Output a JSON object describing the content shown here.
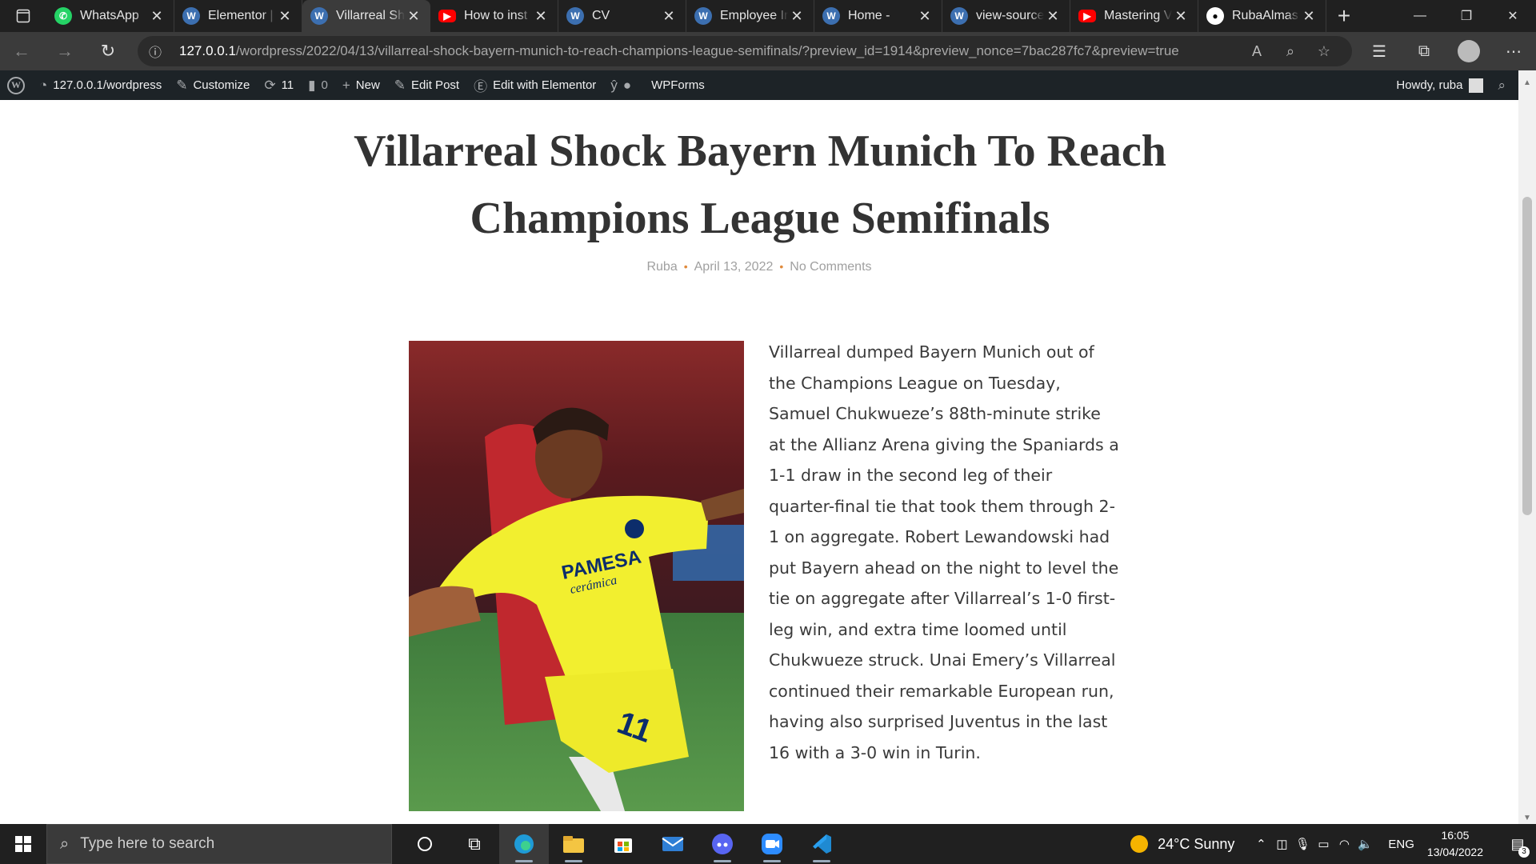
{
  "browser": {
    "tabs": [
      {
        "title": "WhatsApp",
        "favicon": "whatsapp-icon",
        "color": "#25D366",
        "active": false
      },
      {
        "title": "Elementor |",
        "favicon": "elementor-icon",
        "color": "#3c6fb0",
        "active": false
      },
      {
        "title": "Villarreal Sh",
        "favicon": "wordpress-icon",
        "color": "#3c6fb0",
        "active": true
      },
      {
        "title": "How to inst",
        "favicon": "youtube-icon",
        "color": "#ff0000",
        "active": false
      },
      {
        "title": "CV",
        "favicon": "wordpress-icon",
        "color": "#3c6fb0",
        "active": false
      },
      {
        "title": "Employee Ir",
        "favicon": "wordpress-icon",
        "color": "#3c6fb0",
        "active": false
      },
      {
        "title": "Home -",
        "favicon": "wordpress-icon",
        "color": "#3c6fb0",
        "active": false
      },
      {
        "title": "view-source",
        "favicon": "wordpress-icon",
        "color": "#3c6fb0",
        "active": false
      },
      {
        "title": "Mastering V",
        "favicon": "youtube-icon",
        "color": "#ff0000",
        "active": false
      },
      {
        "title": "RubaAlmas",
        "favicon": "github-icon",
        "color": "#000000",
        "active": false
      }
    ],
    "url_host": "127.0.0.1",
    "url_path": "/wordpress/2022/04/13/villarreal-shock-bayern-munich-to-reach-champions-league-semifinals/?preview_id=1914&preview_nonce=7bac287fc7&preview=true"
  },
  "adminbar": {
    "site": "127.0.0.1/wordpress",
    "customize": "Customize",
    "updates": "11",
    "comments": "0",
    "new": "New",
    "edit_post": "Edit Post",
    "edit_elementor": "Edit with Elementor",
    "wpforms": "WPForms",
    "howdy": "Howdy, ruba"
  },
  "post": {
    "title": "Villarreal Shock Bayern Munich To Reach Champions League Semifinals",
    "author": "Ruba",
    "date": "April 13, 2022",
    "comments": "No Comments",
    "body": "Villarreal dumped Bayern Munich out of the Champions League on Tuesday, Samuel Chukwueze’s 88th-minute strike at the Allianz Arena giving the Spaniards a 1-1 draw in the second leg of their quarter-final tie that took them through 2-1 on aggregate. Robert Lewandowski had put Bayern ahead on the night to level the tie on aggregate after Villarreal’s 1-0 first-leg win, and extra time loomed until Chukwueze struck. Unai Emery’s Villarreal continued their remarkable European run, having also surprised Juventus in the last 16 with a 3-0 win in Turin.",
    "image_sponsor": "PAMESA",
    "image_sponsor_sub": "cerámica",
    "image_number": "11"
  },
  "taskbar": {
    "search_placeholder": "Type here to search",
    "weather": "24°C  Sunny",
    "language": "ENG",
    "time": "16:05",
    "date": "13/04/2022",
    "notifications": "3",
    "apps": [
      "task-view-icon",
      "edge-icon",
      "file-explorer-icon",
      "store-icon",
      "mail-icon",
      "discord-icon",
      "zoom-icon",
      "vscode-icon"
    ]
  }
}
